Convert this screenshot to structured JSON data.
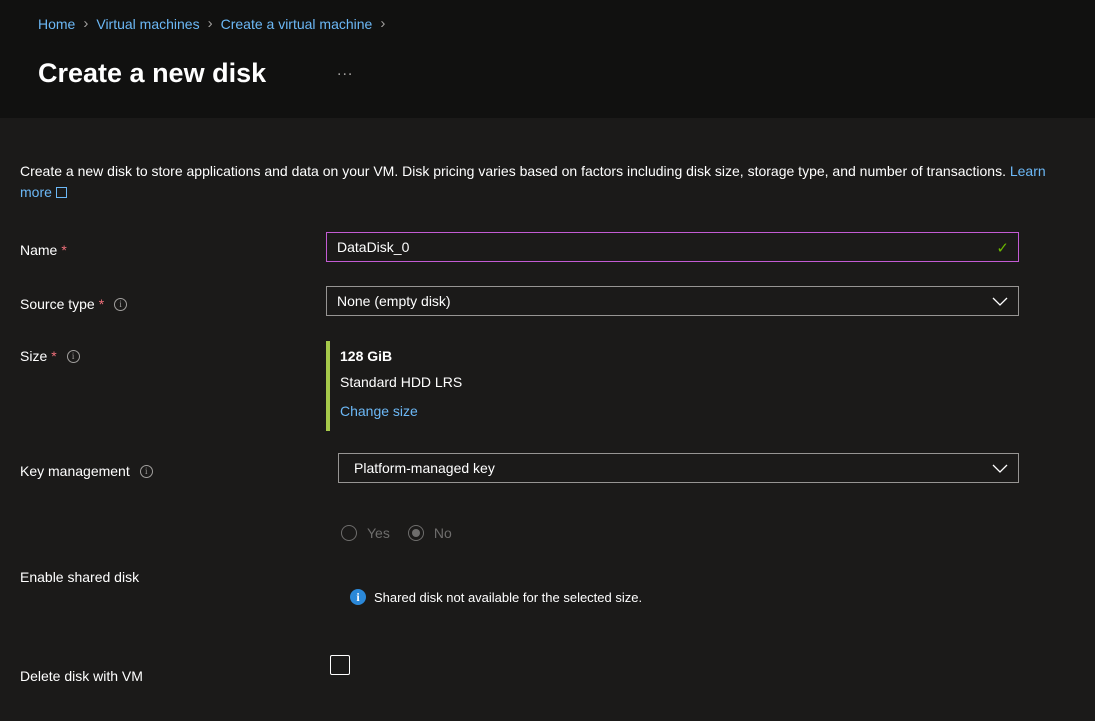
{
  "breadcrumb": [
    "Home",
    "Virtual machines",
    "Create a virtual machine"
  ],
  "page": {
    "title": "Create a new disk",
    "more": "...",
    "description": "Create a new disk to store applications and data on your VM. Disk pricing varies based on factors including disk size, storage type, and number of transactions.",
    "learn_more": "Learn more"
  },
  "form": {
    "name": {
      "label": "Name",
      "value": "DataDisk_0"
    },
    "source_type": {
      "label": "Source type",
      "value": "None (empty disk)"
    },
    "size": {
      "label": "Size",
      "value": "128 GiB",
      "tier": "Standard HDD LRS",
      "change_link": "Change size"
    },
    "key_management": {
      "label": "Key management",
      "value": "Platform-managed key"
    },
    "shared_disk": {
      "label": "Enable shared disk",
      "options": [
        "Yes",
        "No"
      ],
      "selected": "No",
      "notice": "Shared disk not available for the selected size."
    },
    "delete_with_vm": {
      "label": "Delete disk with VM",
      "checked": false
    }
  },
  "required_marker": "*",
  "colors": {
    "accent_link": "#6cb8f6",
    "required": "#f1707b",
    "valid_check": "#6bb700",
    "focus_border": "#c35bd3",
    "size_bar": "#a6c94a",
    "info_blue": "#2b88d8"
  }
}
